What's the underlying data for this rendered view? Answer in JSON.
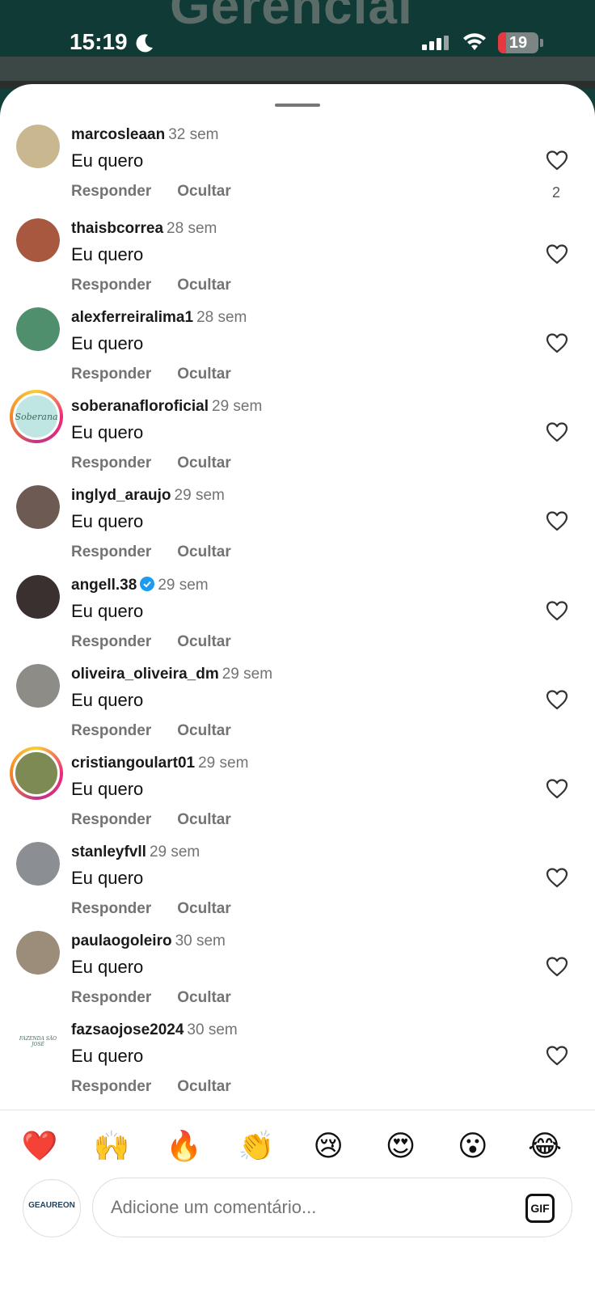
{
  "background": {
    "title": "Gerencial"
  },
  "status_bar": {
    "time": "15:19",
    "battery_level": "19",
    "battery_fraction": 0.19,
    "icons": [
      "moon-icon",
      "signal-icon",
      "wifi-icon",
      "battery-icon"
    ]
  },
  "comments": [
    {
      "username": "marcosleaan",
      "time": "32 sem",
      "text": "Eu quero",
      "reply": "Responder",
      "hide": "Ocultar",
      "likes": "2",
      "ring": false,
      "verified": false,
      "avatar_color": "#c9b88f"
    },
    {
      "username": "thaisbcorrea",
      "time": "28 sem",
      "text": "Eu quero",
      "reply": "Responder",
      "hide": "Ocultar",
      "likes": "",
      "ring": false,
      "verified": false,
      "avatar_color": "#a8583f"
    },
    {
      "username": "alexferreiralima1",
      "time": "28 sem",
      "text": "Eu quero",
      "reply": "Responder",
      "hide": "Ocultar",
      "likes": "",
      "ring": false,
      "verified": false,
      "avatar_color": "#4f8f6e"
    },
    {
      "username": "soberanafloroficial",
      "time": "29 sem",
      "text": "Eu quero",
      "reply": "Responder",
      "hide": "Ocultar",
      "likes": "",
      "ring": true,
      "verified": false,
      "avatar_color": "#bfe6e3",
      "avatar_label": "Soberana"
    },
    {
      "username": "inglyd_araujo",
      "time": "29 sem",
      "text": "Eu quero",
      "reply": "Responder",
      "hide": "Ocultar",
      "likes": "",
      "ring": false,
      "verified": false,
      "avatar_color": "#6d5a52"
    },
    {
      "username": "angell.38",
      "time": "29 sem",
      "text": "Eu quero",
      "reply": "Responder",
      "hide": "Ocultar",
      "likes": "",
      "ring": false,
      "verified": true,
      "avatar_color": "#3b3030"
    },
    {
      "username": "oliveira_oliveira_dm",
      "time": "29 sem",
      "text": "Eu quero",
      "reply": "Responder",
      "hide": "Ocultar",
      "likes": "",
      "ring": false,
      "verified": false,
      "avatar_color": "#8d8c86"
    },
    {
      "username": "cristiangoulart01",
      "time": "29 sem",
      "text": "Eu quero",
      "reply": "Responder",
      "hide": "Ocultar",
      "likes": "",
      "ring": true,
      "verified": false,
      "avatar_color": "#7d8a54"
    },
    {
      "username": "stanleyfvll",
      "time": "29 sem",
      "text": "Eu quero",
      "reply": "Responder",
      "hide": "Ocultar",
      "likes": "",
      "ring": false,
      "verified": false,
      "avatar_color": "#8b8e92"
    },
    {
      "username": "paulaogoleiro",
      "time": "30 sem",
      "text": "Eu quero",
      "reply": "Responder",
      "hide": "Ocultar",
      "likes": "",
      "ring": false,
      "verified": false,
      "avatar_color": "#9b8d7a"
    },
    {
      "username": "fazsaojose2024",
      "time": "30 sem",
      "text": "Eu quero",
      "reply": "Responder",
      "hide": "Ocultar",
      "likes": "",
      "ring": false,
      "verified": false,
      "avatar_color": "#ffffff",
      "avatar_label": "FAZENDA SÃO JOSÉ"
    }
  ],
  "emoji_bar": [
    "❤️",
    "🙌",
    "🔥",
    "👏",
    "😢",
    "😍",
    "😮",
    "😂"
  ],
  "composer": {
    "avatar_label": "GEAUREON",
    "placeholder": "Adicione um comentário...",
    "gif_label": "GIF"
  },
  "colors": {
    "accent_heart": "#e0245e",
    "verified_blue": "#1d9bf0",
    "muted_text": "#737373"
  }
}
